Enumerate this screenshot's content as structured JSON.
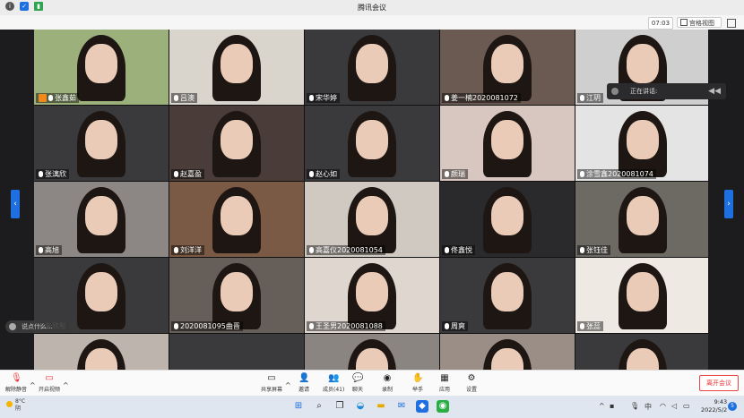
{
  "window": {
    "title": "腾讯会议"
  },
  "infobar": {
    "time": "07:03",
    "view_label": "宫格视图"
  },
  "speaking": {
    "label": "正在讲话:"
  },
  "chat_preview": {
    "text": "说点什么..."
  },
  "participants": [
    {
      "name": "张鑫茹",
      "host": true
    },
    {
      "name": "吕澳"
    },
    {
      "name": "宋华婷"
    },
    {
      "name": "姜一楠2020081072"
    },
    {
      "name": "江玥"
    },
    {
      "name": "张漓欣"
    },
    {
      "name": "赵嘉盈"
    },
    {
      "name": "赵心如"
    },
    {
      "name": "颜瑞"
    },
    {
      "name": "涂雪鑫2020081074"
    },
    {
      "name": "高旭"
    },
    {
      "name": "刘洋洋"
    },
    {
      "name": "高嘉仪2020081054"
    },
    {
      "name": "佟鑫悦"
    },
    {
      "name": "张钰佳"
    },
    {
      "name": "朱欣彤"
    },
    {
      "name": "2020081095曲晋"
    },
    {
      "name": "王圣男2020081088"
    },
    {
      "name": "周爽"
    },
    {
      "name": "张蕊"
    },
    {
      "name": ""
    },
    {
      "name": ""
    },
    {
      "name": ""
    },
    {
      "name": ""
    },
    {
      "name": ""
    }
  ],
  "toolbar": {
    "unmute": "解除静音",
    "video": "开启视频",
    "share": "共享屏幕",
    "invite": "邀请",
    "members": "成员(41)",
    "chat": "聊天",
    "record": "录制",
    "raise_hand": "举手",
    "apps": "应用",
    "settings": "设置",
    "leave": "离开会议"
  },
  "taskbar": {
    "weather_temp": "8°C",
    "weather_desc": "阴",
    "time": "9:43",
    "date": "2022/5/2",
    "ime": "中",
    "notifications": "5"
  }
}
